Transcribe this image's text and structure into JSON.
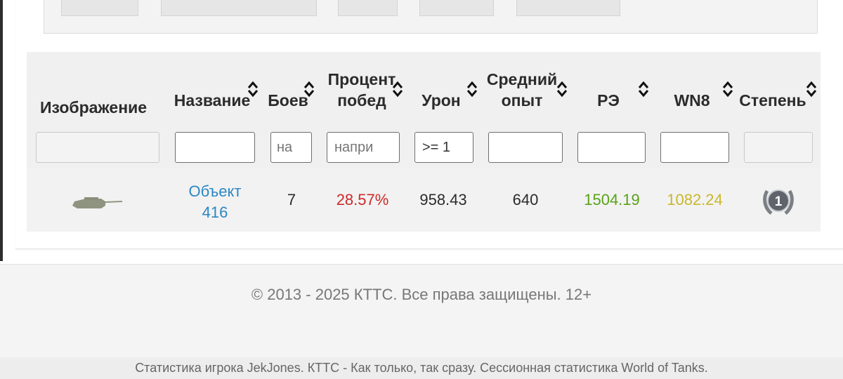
{
  "table": {
    "headers": {
      "image": "Изображение",
      "name": "Название",
      "battles": "Боев",
      "winrate": [
        "Процент",
        "побед"
      ],
      "damage": "Урон",
      "avgxp": [
        "Средний",
        "опыт"
      ],
      "re": "РЭ",
      "wn8": "WN8",
      "mastery": "Степень"
    },
    "filters": {
      "battles_placeholder": "на",
      "winrate_placeholder": "напри",
      "damage_value": ">= 1"
    },
    "rows": [
      {
        "name_line1": "Объект",
        "name_line2": "416",
        "battles": "7",
        "winrate": "28.57%",
        "damage": "958.43",
        "avg_xp": "640",
        "re": "1504.19",
        "wn8": "1082.24",
        "mastery_badge": "1"
      }
    ]
  },
  "colors": {
    "link": "#2b87c4",
    "winrate_bad": "#cc2a2a",
    "re_good": "#5aa217",
    "wn8_avg": "#c9b82a"
  },
  "icons": {
    "sort": "sort-arrows-icon",
    "tank": "tank-icon",
    "mastery": "mastery-badge-icon"
  },
  "footer": {
    "copyright": "© 2013 - 2025 КТТС. Все права защищены. 12+",
    "subfooter": "Статистика игрока JekJones. КТТС - Как только, так сразу. Сессионная статистика World of Tanks."
  }
}
